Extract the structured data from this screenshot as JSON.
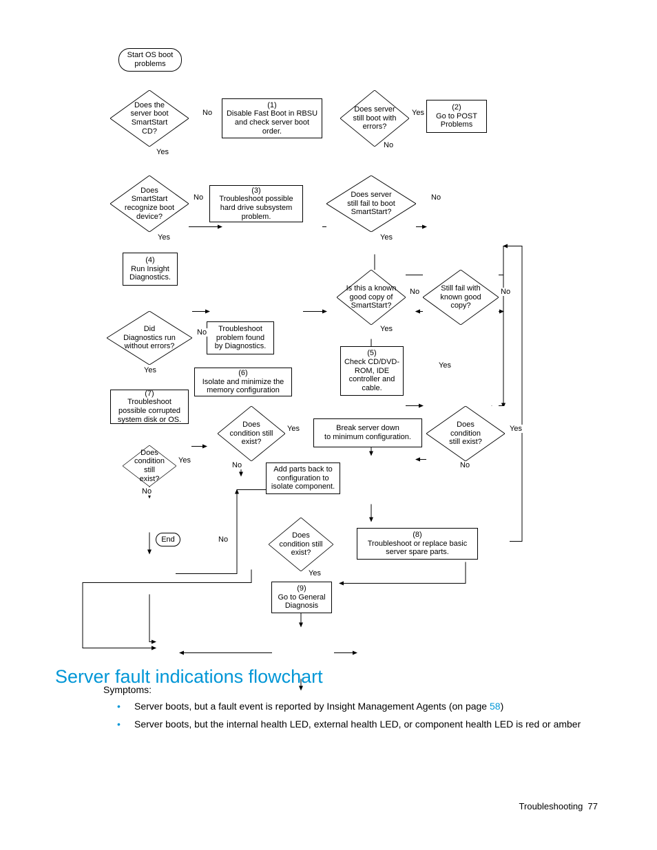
{
  "nodes": {
    "start": "Start OS boot\nproblems",
    "d_boot_cd": "Does the\nserver boot\nSmartStart\nCD?",
    "p1": "(1)\nDisable Fast Boot in RBSU\nand check server boot\norder.",
    "d_boot_err": "Does server\nstill boot with\nerrors?",
    "p2": "(2)\nGo to POST\nProblems",
    "d_recog": "Does\nSmartStart\nrecognize boot\ndevice?",
    "p3": "(3)\nTroubleshoot possible\nhard drive subsystem\nproblem.",
    "d_fail_ss": "Does server\nstill fail to boot\nSmartStart?",
    "p4": "(4)\nRun Insight\nDiagnostics.",
    "d_known": "Is this a known\ngood copy of\nSmartStart?",
    "d_still_fail": "Still fail with\nknown good\ncopy?",
    "d_diag_ok": "Did\nDiagnostics run\nwithout errors?",
    "p_found": "Troubleshoot\nproblem found\nby Diagnostics.",
    "p5": "(5)\nCheck CD/DVD-\nROM, IDE\ncontroller and\ncable.",
    "p6": "(6)\nIsolate and minimize the\nmemory configuration",
    "p7": "(7)\nTroubleshoot\npossible corrupted\nsystem disk or OS.",
    "d_cond1": "Does\ncondition still\nexist?",
    "p_break": "Break server down\nto minimum configuration.",
    "d_cond2": "Does\ncondition\nstill exist?",
    "d_cond3": "Does\ncondition still\nexist?",
    "p_addback": "Add parts back to\nconfiguration to\nisolate component.",
    "d_cond4": "Does\ncondition still\nexist?",
    "p8": "(8)\nTroubleshoot or replace basic\nserver spare parts.",
    "end": "End",
    "p9": "(9)\nGo to General\nDiagnosis"
  },
  "labels": {
    "yes": "Yes",
    "no": "No"
  },
  "section_title": "Server fault indications flowchart",
  "symptoms_label": "Symptoms:",
  "bullet1_a": "Server boots, but a fault event is reported by Insight Management Agents (on page ",
  "bullet1_link": "58",
  "bullet1_b": ")",
  "bullet2": "Server boots, but the internal health LED, external health LED, or component health LED is red or amber",
  "footer_section": "Troubleshooting",
  "footer_page": "77"
}
